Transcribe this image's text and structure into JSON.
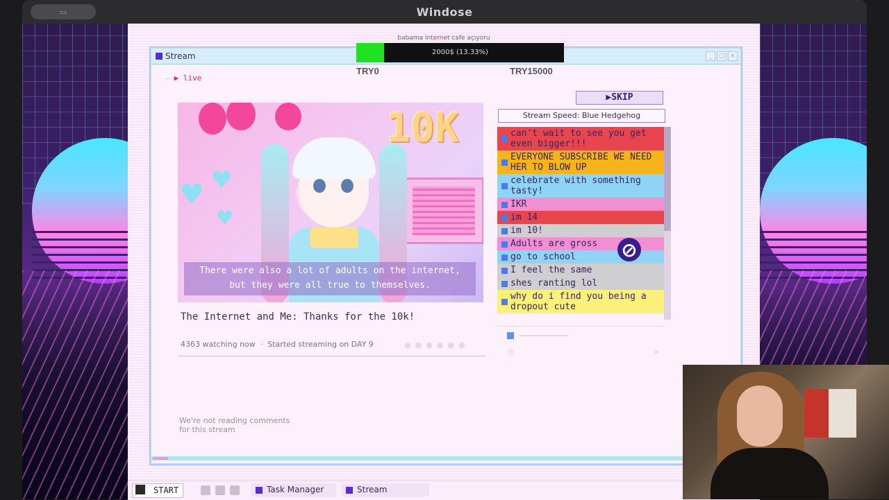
{
  "mac": {
    "title": "Windose"
  },
  "desktop": {
    "header": "babama internet cafe açıyoru"
  },
  "progress": {
    "text": "2000$ (13.33%)",
    "fraction": 0.1333,
    "goal_start": "TRY0",
    "goal_end": "TRY15000"
  },
  "window": {
    "title": "Stream",
    "live_label": "▶ live"
  },
  "skip": {
    "label": "▶SKIP"
  },
  "video": {
    "overlay_text": "10K",
    "caption_line1": "There were also a lot of adults on the internet,",
    "caption_line2": "but they were all true to themselves."
  },
  "stream": {
    "title": "The Internet and Me: Thanks for the 10k!",
    "watching": "4363 watching now",
    "separator": "·",
    "started": "Started streaming on DAY 9",
    "no_comments_line1": "We're not reading comments",
    "no_comments_line2": "for this stream"
  },
  "chat": {
    "speed_label": "Stream Speed: Blue Hedgehog",
    "messages": [
      {
        "text": "can't wait to see you get even bigger!!!",
        "bg": "#e8464f"
      },
      {
        "text": "EVERYONE SUBSCRIBE WE NEED HER TO BLOW UP",
        "bg": "#f6b41a"
      },
      {
        "text": "celebrate with something tasty!",
        "bg": "#8fd4f5"
      },
      {
        "text": "IKR",
        "bg": "#f18fd3"
      },
      {
        "text": "im 14",
        "bg": "#e8464f"
      },
      {
        "text": "im 10!",
        "bg": "#cfcfd1"
      },
      {
        "text": "Adults are gross",
        "bg": "#f18fd3"
      },
      {
        "text": "go to school",
        "bg": "#8fd4f5"
      },
      {
        "text": "I feel the same",
        "bg": "#cfcfd1"
      },
      {
        "text": "shes ranting lol",
        "bg": "#cfcfd1"
      },
      {
        "text": "why do i find you being a dropout cute",
        "bg": "#faf07a"
      }
    ]
  },
  "taskbar": {
    "start": "START",
    "task_manager": "Task Manager",
    "stream": "Stream"
  },
  "colors": {
    "accent": "#5a2ccf",
    "progress_green": "#22e022"
  }
}
